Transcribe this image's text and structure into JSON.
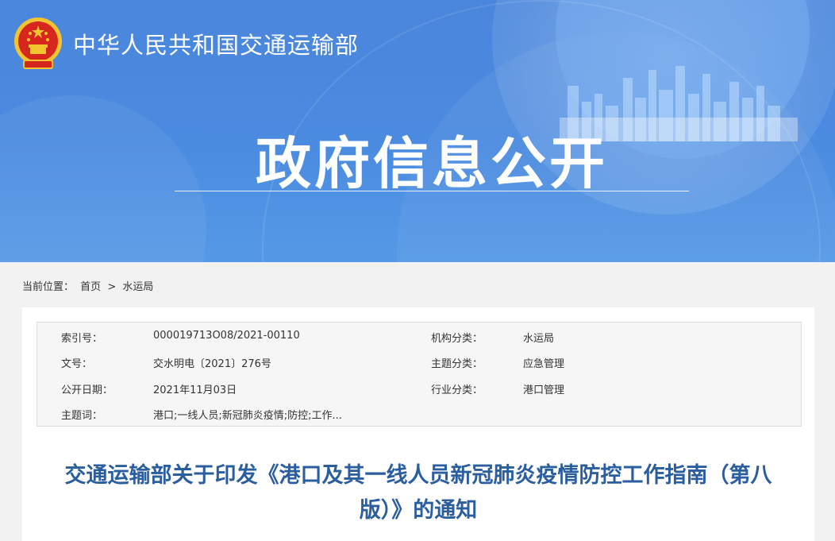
{
  "header": {
    "ministry_name": "中华人民共和国交通运输部",
    "section_title": "政府信息公开"
  },
  "breadcrumb": {
    "label": "当前位置：",
    "home": "首页",
    "separator": ">",
    "current": "水运局"
  },
  "meta": {
    "index_no_label": "索引号：",
    "index_no": "000019713O08/2021-00110",
    "org_label": "机构分类：",
    "org": "水运局",
    "doc_no_label": "文号：",
    "doc_no": "交水明电〔2021〕276号",
    "topic_label": "主题分类：",
    "topic": "应急管理",
    "date_label": "公开日期：",
    "date": "2021年11月03日",
    "industry_label": "行业分类：",
    "industry": "港口管理",
    "keywords_label": "主题词：",
    "keywords": "港口;一线人员;新冠肺炎疫情;防控;工作..."
  },
  "document": {
    "title_line1": "交通运输部关于印发《港口及其一线人员新冠肺炎疫情防控工作指南（第八",
    "title_line2": "版）》的通知"
  },
  "colors": {
    "banner_blue": "#4a86dc",
    "title_blue": "#2b5e9e",
    "emblem_red": "#d7261e",
    "emblem_gold": "#f4c430"
  }
}
